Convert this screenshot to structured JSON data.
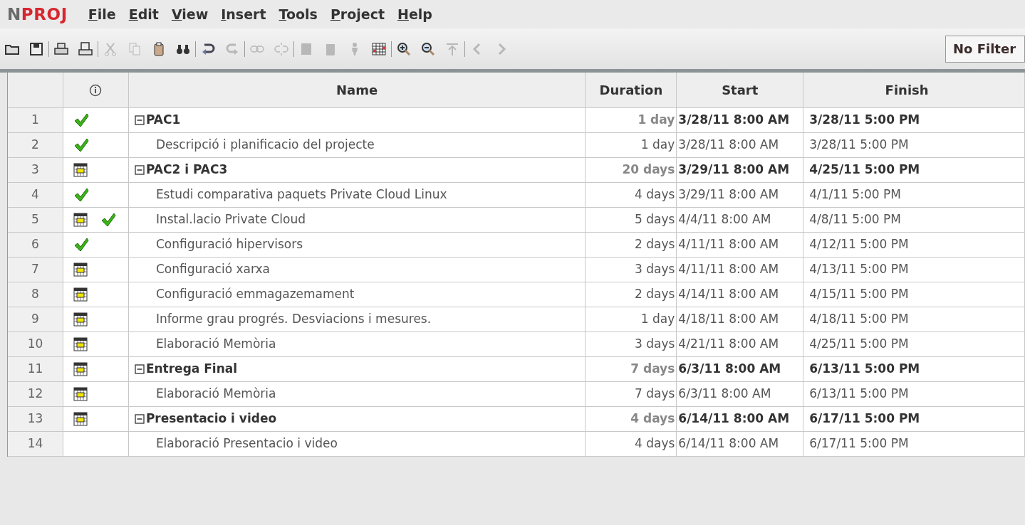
{
  "logo": {
    "first": "N",
    "rest": "PROJ"
  },
  "menu": [
    "File",
    "Edit",
    "View",
    "Insert",
    "Tools",
    "Project",
    "Help"
  ],
  "toolbar": [
    [
      {
        "disabled": false
      },
      {
        "disabled": false
      }
    ],
    [
      {
        "disabled": false
      },
      {
        "disabled": false
      }
    ],
    [
      {
        "disabled": true
      },
      {
        "disabled": true
      },
      {
        "disabled": false
      },
      {
        "disabled": false
      }
    ],
    [
      {
        "disabled": false
      },
      {
        "disabled": true
      }
    ],
    [
      {
        "disabled": true
      },
      {
        "disabled": true
      }
    ],
    [
      {
        "disabled": true
      },
      {
        "disabled": true
      },
      {
        "disabled": true
      },
      {
        "disabled": false
      }
    ],
    [
      {
        "disabled": false
      },
      {
        "disabled": false
      },
      {
        "disabled": true
      }
    ],
    [
      {
        "disabled": true
      },
      {
        "disabled": true
      }
    ]
  ],
  "filter": {
    "value": "No Filter"
  },
  "table": {
    "columns": [
      "Name",
      "Duration",
      "Start",
      "Finish"
    ],
    "tasks": [
      {
        "row": "1",
        "calendar": false,
        "done": true,
        "name": "PAC1",
        "duration": "1 day",
        "start": "3/28/11 8:00 AM",
        "finish": "3/28/11 5:00 PM",
        "expanded": true,
        "children": [
          {
            "row": "2",
            "calendar": false,
            "done": true,
            "name": "Descripció i planificacio del projecte",
            "duration": "1 day",
            "start": "3/28/11 8:00 AM",
            "finish": "3/28/11 5:00 PM"
          }
        ]
      },
      {
        "row": "3",
        "calendar": true,
        "done": false,
        "name": "PAC2 i PAC3",
        "duration": "20 days",
        "start": "3/29/11 8:00 AM",
        "finish": "4/25/11 5:00 PM",
        "expanded": true,
        "children": [
          {
            "row": "4",
            "calendar": false,
            "done": true,
            "name": "Estudi comparativa paquets Private Cloud Linux",
            "duration": "4 days",
            "start": "3/29/11 8:00 AM",
            "finish": "4/1/11 5:00 PM"
          },
          {
            "row": "5",
            "calendar": true,
            "done": true,
            "name": "Instal.lacio Private Cloud",
            "duration": "5 days",
            "start": "4/4/11 8:00 AM",
            "finish": "4/8/11 5:00 PM"
          },
          {
            "row": "6",
            "calendar": false,
            "done": true,
            "name": "Configuració hipervisors",
            "duration": "2 days",
            "start": "4/11/11 8:00 AM",
            "finish": "4/12/11 5:00 PM"
          },
          {
            "row": "7",
            "calendar": true,
            "done": false,
            "name": "Configuració xarxa",
            "duration": "3 days",
            "start": "4/11/11 8:00 AM",
            "finish": "4/13/11 5:00 PM"
          },
          {
            "row": "8",
            "calendar": true,
            "done": false,
            "name": "Configuració emmagazemament",
            "duration": "2 days",
            "start": "4/14/11 8:00 AM",
            "finish": "4/15/11 5:00 PM"
          },
          {
            "row": "9",
            "calendar": true,
            "done": false,
            "name": "Informe grau progrés. Desviacions i mesures.",
            "duration": "1 day",
            "start": "4/18/11 8:00 AM",
            "finish": "4/18/11 5:00 PM"
          },
          {
            "row": "10",
            "calendar": true,
            "done": false,
            "name": "Elaboració Memòria",
            "duration": "3 days",
            "start": "4/21/11 8:00 AM",
            "finish": "4/25/11 5:00 PM"
          }
        ]
      },
      {
        "row": "11",
        "calendar": true,
        "done": false,
        "name": "Entrega Final",
        "duration": "7 days",
        "start": "6/3/11 8:00 AM",
        "finish": "6/13/11 5:00 PM",
        "expanded": true,
        "children": [
          {
            "row": "12",
            "calendar": true,
            "done": false,
            "name": "Elaboració Memòria",
            "duration": "7 days",
            "start": "6/3/11 8:00 AM",
            "finish": "6/13/11 5:00 PM"
          }
        ]
      },
      {
        "row": "13",
        "calendar": true,
        "done": false,
        "name": "Presentacio i video",
        "duration": "4 days",
        "start": "6/14/11 8:00 AM",
        "finish": "6/17/11 5:00 PM",
        "expanded": true,
        "children": [
          {
            "row": "14",
            "calendar": false,
            "done": false,
            "name": "Elaboració Presentacio i video",
            "duration": "4 days",
            "start": "6/14/11 8:00 AM",
            "finish": "6/17/11 5:00 PM"
          }
        ]
      }
    ]
  }
}
